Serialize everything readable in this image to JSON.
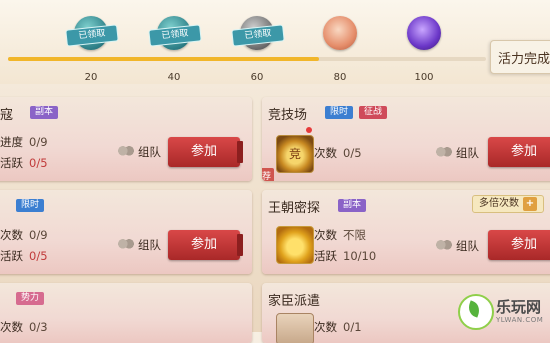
{
  "progress": {
    "value": 65,
    "max": 100,
    "fill_color": "#f1b62a",
    "milestones": [
      {
        "value": "20",
        "badge": "已领取",
        "icon": "treasure-chest-icon"
      },
      {
        "value": "40",
        "badge": "已领取",
        "icon": "treasure-chest-icon"
      },
      {
        "value": "60",
        "badge": "已领取",
        "icon": "treasure-chest-icon"
      },
      {
        "value": "80",
        "badge": "",
        "icon": "fan-icon"
      },
      {
        "value": "100",
        "badge": "",
        "icon": "gem-icon"
      }
    ],
    "panel_label": "活力完成"
  },
  "cards": {
    "c1": {
      "title": "寇",
      "tag": "副本",
      "s1_label": "进度",
      "s1_value": "0/9",
      "s2_label": "活跃",
      "s2_value": "0/5",
      "team": "组队",
      "button": "参加"
    },
    "c2": {
      "title": "竞技场",
      "tag1": "限时",
      "tag2": "征战",
      "s1_label": "次数",
      "s1_value": "0/5",
      "team": "组队",
      "button": "参加",
      "icon_text": "竞",
      "corner": "荐"
    },
    "c3": {
      "tag": "限时",
      "s1_label": "次数",
      "s1_value": "0/9",
      "s2_label": "活跃",
      "s2_value": "0/5",
      "team": "组队",
      "button": "参加"
    },
    "c4": {
      "title": "王朝密探",
      "tag": "副本",
      "s1_label": "次数",
      "s1_value": "不限",
      "s2_label": "活跃",
      "s2_value": "10/10",
      "team": "组队",
      "button": "参加",
      "double": "多倍次数",
      "double_plus": "+"
    },
    "c5": {
      "tag": "势力",
      "s1_label": "次数",
      "s1_value": "0/3"
    },
    "c6": {
      "title": "家臣派遣",
      "s1_label": "次数",
      "s1_value": "0/1"
    }
  },
  "watermark": {
    "text": "乐玩网",
    "sub": "YLWAN.COM"
  }
}
